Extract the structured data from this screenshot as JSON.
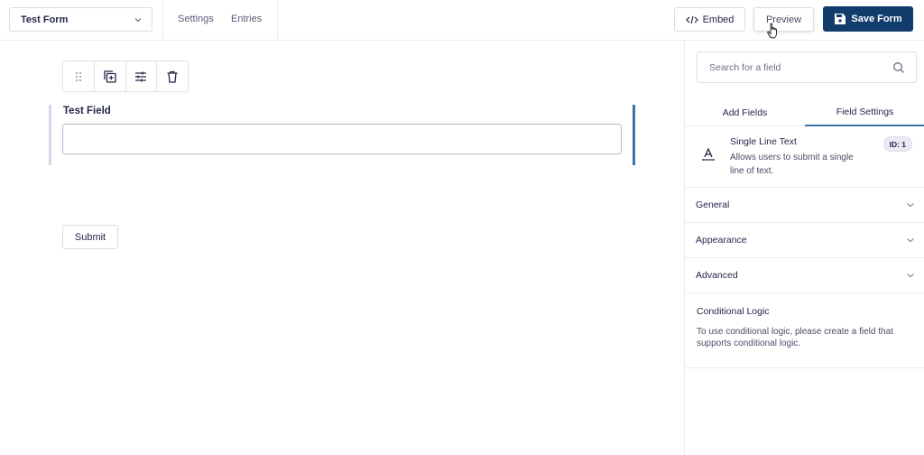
{
  "header": {
    "form_selector": "Test Form",
    "nav": [
      "Settings",
      "Entries"
    ],
    "embed_label": "Embed",
    "preview_label": "Preview",
    "save_label": "Save Form"
  },
  "canvas": {
    "toolbar_icons": [
      "drag-handle-icon",
      "duplicate-icon",
      "settings-sliders-icon",
      "trash-icon"
    ],
    "field": {
      "label": "Test Field",
      "value": ""
    },
    "submit_label": "Submit"
  },
  "sidebar": {
    "search_placeholder": "Search for a field",
    "tabs": [
      {
        "label": "Add Fields",
        "active": false
      },
      {
        "label": "Field Settings",
        "active": true
      }
    ],
    "field_info": {
      "title": "Single Line Text",
      "description": "Allows users to submit a single line of text.",
      "badge": "ID: 1"
    },
    "sections": [
      "General",
      "Appearance",
      "Advanced"
    ],
    "conditional_logic": {
      "title": "Conditional Logic",
      "text": "To use conditional logic, please create a field that supports conditional logic."
    }
  },
  "colors": {
    "primary": "#123c6b",
    "accent": "#3e73a8",
    "text": "#242748"
  }
}
